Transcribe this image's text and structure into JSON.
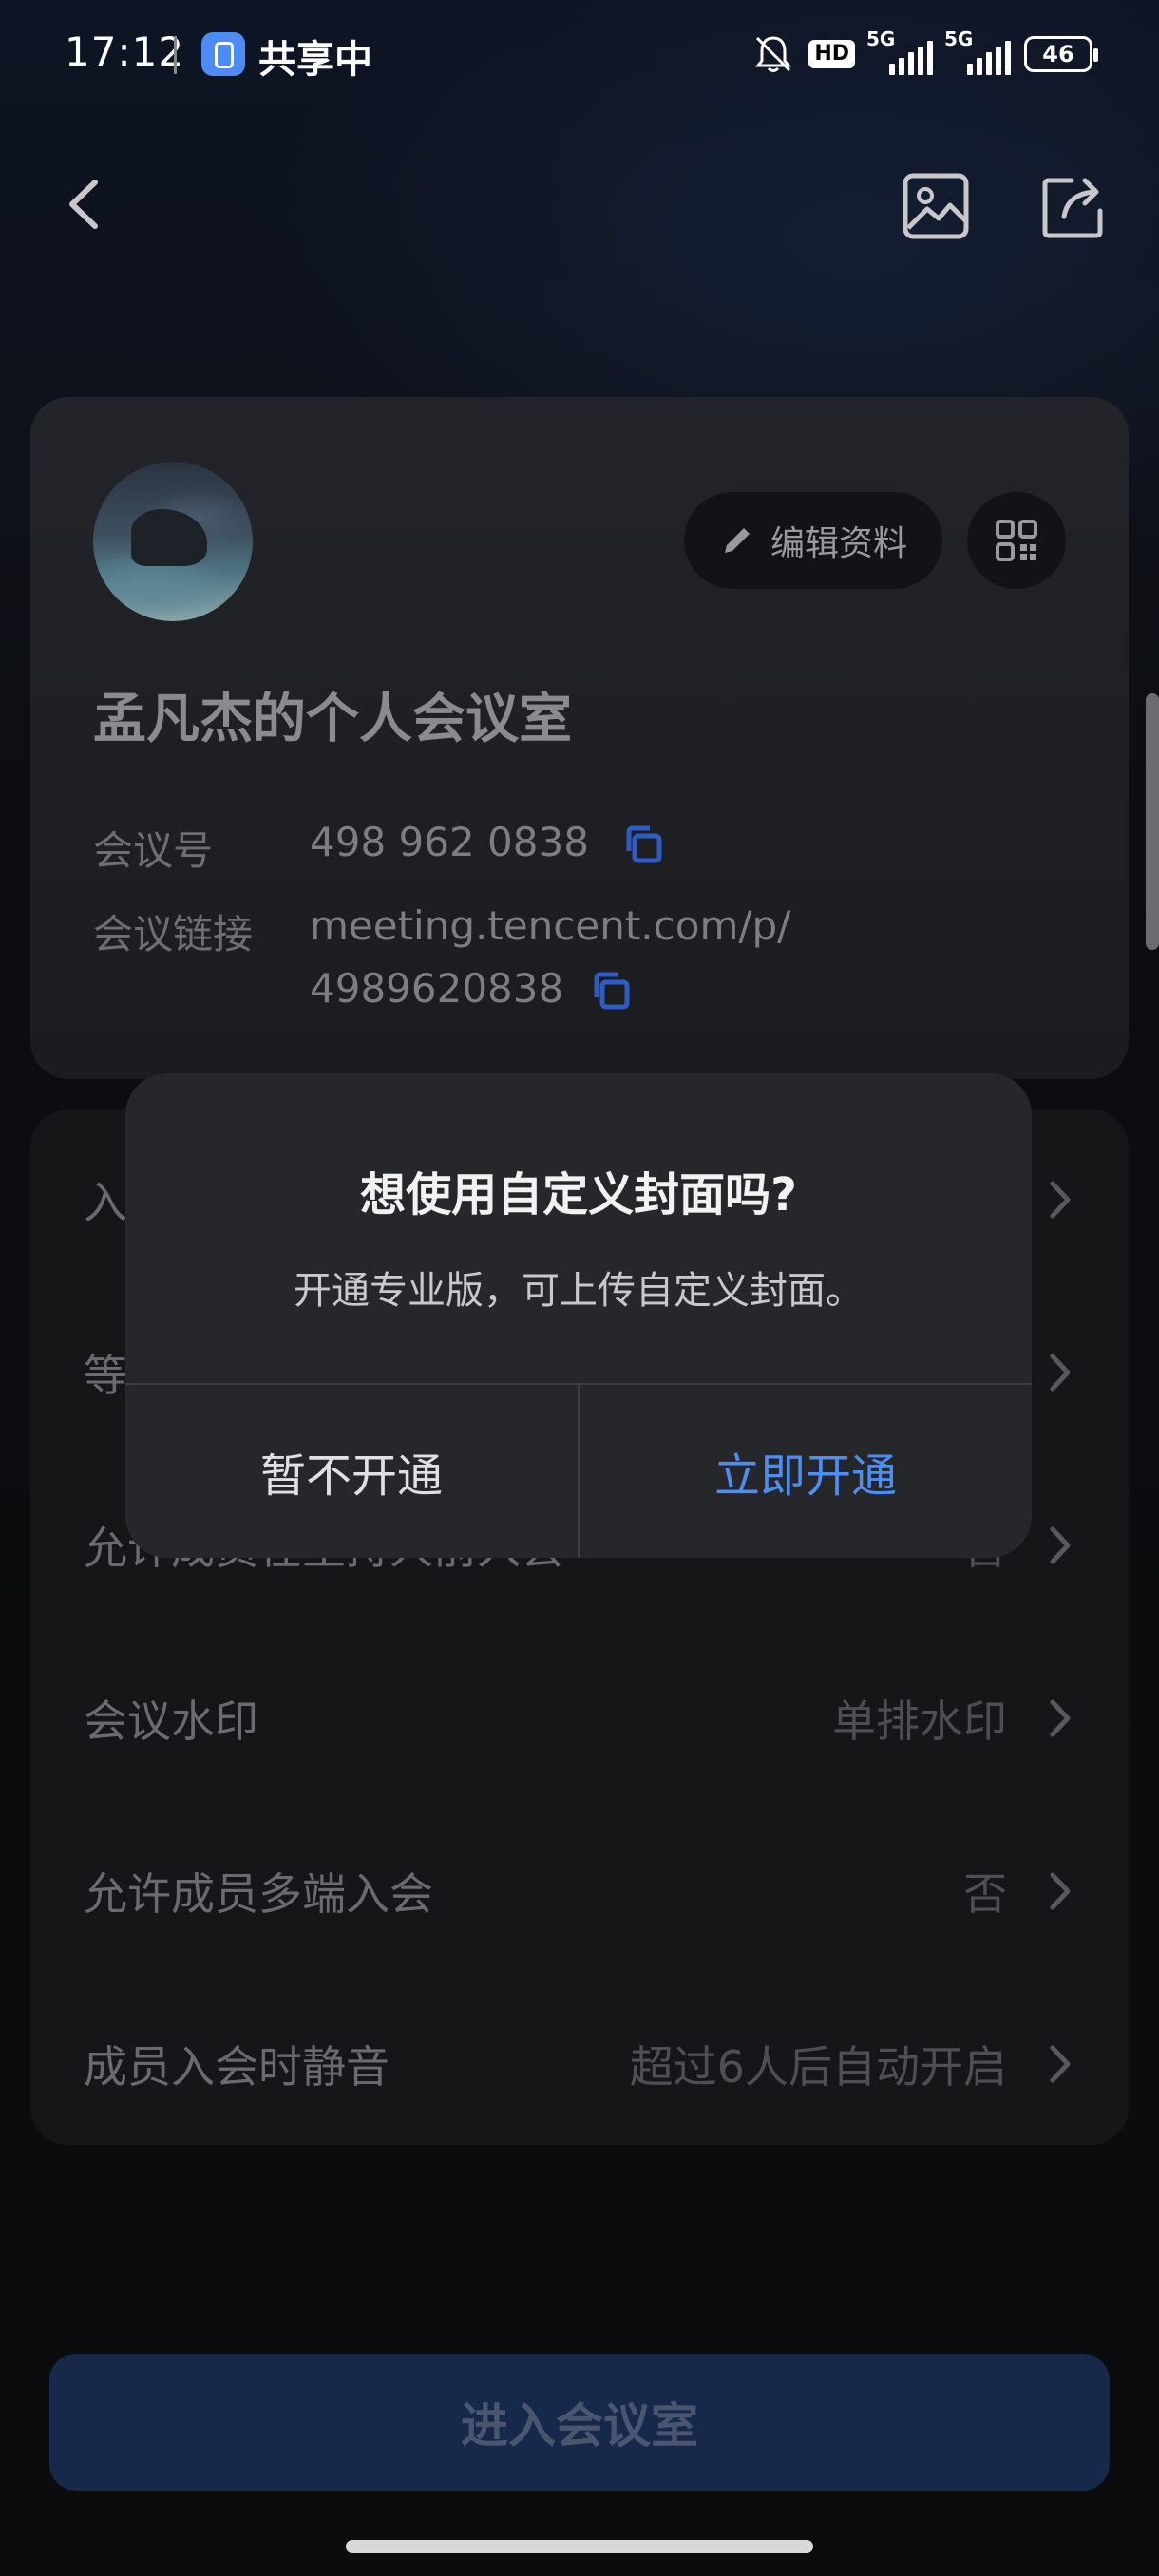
{
  "status_bar": {
    "time": "17:12",
    "sharing_label": "共享中",
    "hd_badge": "HD",
    "network_1": "5G",
    "network_2": "5G",
    "battery": "46"
  },
  "nav": {
    "back_icon": "chevron-left-icon",
    "cover_icon": "image-icon",
    "share_icon": "share-icon"
  },
  "profile": {
    "edit_label": "编辑资料",
    "room_title": "孟凡杰的个人会议室",
    "meeting_id_label": "会议号",
    "meeting_id": "498 962 0838",
    "meeting_link_label": "会议链接",
    "meeting_link_line1": "meeting.tencent.com/p/",
    "meeting_link_line2": "4989620838"
  },
  "settings": [
    {
      "label": "入",
      "value": ""
    },
    {
      "label": "等",
      "value": ""
    },
    {
      "label": "允许成员在主持人前入会",
      "value": "否"
    },
    {
      "label": "会议水印",
      "value": "单排水印"
    },
    {
      "label": "允许成员多端入会",
      "value": "否"
    },
    {
      "label": "成员入会时静音",
      "value": "超过6人后自动开启"
    }
  ],
  "dialog": {
    "title": "想使用自定义封面吗?",
    "message": "开通专业版，可上传自定义封面。",
    "cancel_label": "暂不开通",
    "confirm_label": "立即开通"
  },
  "enter_button": "进入会议室",
  "colors": {
    "accent": "#4d8ef3",
    "enter_button_bg": "#16294a",
    "dialog_bg": "#26272b"
  }
}
